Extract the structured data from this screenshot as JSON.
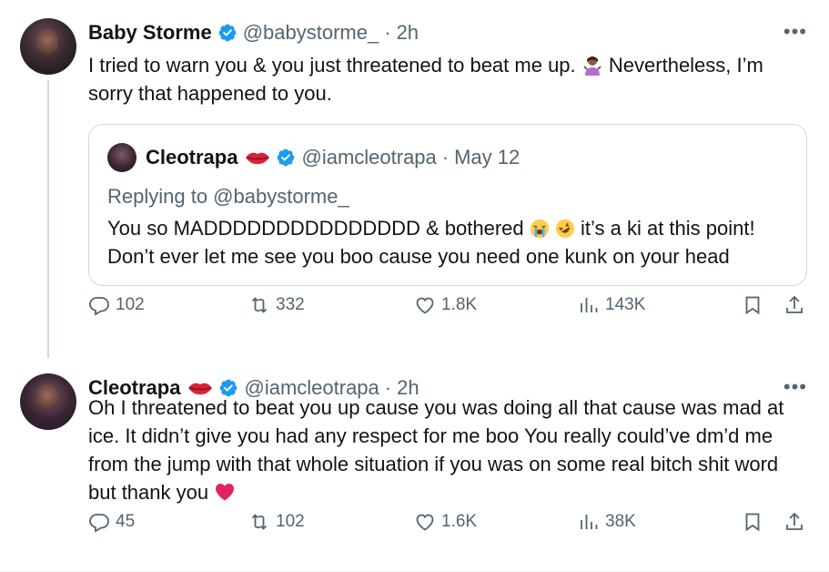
{
  "tweets": [
    {
      "name": "Baby Storme",
      "handle": "@babystorme_",
      "separator": "·",
      "time": "2h",
      "more": "•••",
      "text_before": "I tried to warn you & you just threatened to beat me up.",
      "emoji": "person-shrugging",
      "text_after": " Nevertheless, I’m sorry that happened to you.",
      "quote": {
        "name": "Cleotrapa",
        "handle": "@iamcleotrapa",
        "separator": "·",
        "date": "May 12",
        "replying": "Replying to @babystorme_",
        "text_before": "You so MADDDDDDDDDDDDDDD & bothered ",
        "emojis": [
          "crying-face",
          "rolling-laughing-face"
        ],
        "text_after": " it’s a ki at this point! Don’t ever let me see you boo cause you need one kunk on your head"
      },
      "stats": {
        "replies": "102",
        "retweets": "332",
        "likes": "1.8K",
        "views": "143K"
      }
    },
    {
      "name": "Cleotrapa",
      "handle": "@iamcleotrapa",
      "separator": "·",
      "time": "2h",
      "more": "•••",
      "text": "Oh I threatened to beat you up cause you was doing all that cause was mad at ice. It didn’t give you had any respect for me boo You really could’ve dm’d me from the jump with that whole situation if you was on some real bitch shit word but thank you ",
      "emoji": "red-heart",
      "stats": {
        "replies": "45",
        "retweets": "102",
        "likes": "1.6K",
        "views": "38K"
      }
    }
  ],
  "colors": {
    "verified": "#1d9bf0",
    "secondary": "#536471",
    "text": "#0f1419",
    "border": "#cfd9de",
    "heart": "#e0245e"
  }
}
